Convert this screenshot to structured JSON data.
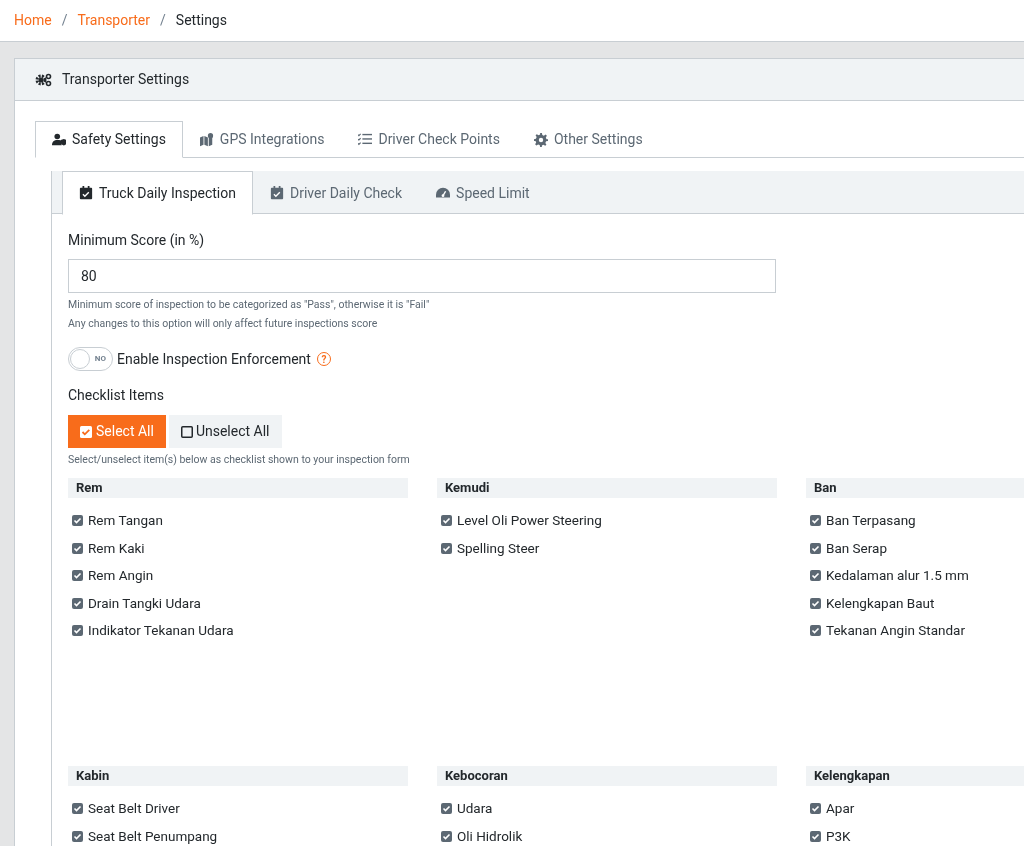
{
  "breadcrumb": [
    {
      "label": "Home",
      "link": true,
      "separator": "/"
    },
    {
      "label": "Transporter",
      "link": true,
      "separator": "/"
    },
    {
      "label": "Settings",
      "link": false
    }
  ],
  "card": {
    "title": "Transporter Settings"
  },
  "tabs": [
    {
      "label": "Safety Settings",
      "selected": true
    },
    {
      "label": "GPS Integrations",
      "selected": false
    },
    {
      "label": "Driver Check Points",
      "selected": false
    },
    {
      "label": "Other Settings",
      "selected": false
    }
  ],
  "subtabs": [
    {
      "label": "Truck Daily Inspection",
      "selected": true
    },
    {
      "label": "Driver Daily Check",
      "selected": false
    },
    {
      "label": "Speed Limit",
      "selected": false
    }
  ],
  "minimum_score": {
    "label": "Minimum Score (in %)",
    "value": "80",
    "help": [
      "Minimum score of inspection to be categorized as \"Pass\", otherwise it is \"Fail\"",
      "Any changes to this option will only affect future inspections score"
    ]
  },
  "enforcement": {
    "label": "Enable Inspection Enforcement",
    "on": false,
    "off_text": "NO",
    "help_icon": "?"
  },
  "checklist": {
    "label": "Checklist Items",
    "select_all": "Select All",
    "unselect_all": "Unselect All",
    "help": "Select/unselect item(s) below as checklist shown to your inspection form",
    "groups": [
      {
        "title": "Rem",
        "items": [
          {
            "label": "Rem Tangan",
            "checked": true
          },
          {
            "label": "Rem Kaki",
            "checked": true
          },
          {
            "label": "Rem Angin",
            "checked": true
          },
          {
            "label": "Drain Tangki Udara",
            "checked": true
          },
          {
            "label": "Indikator Tekanan Udara",
            "checked": true
          }
        ]
      },
      {
        "title": "Kemudi",
        "items": [
          {
            "label": "Level Oli Power Steering",
            "checked": true
          },
          {
            "label": "Spelling Steer",
            "checked": true
          }
        ]
      },
      {
        "title": "Ban",
        "items": [
          {
            "label": "Ban Terpasang",
            "checked": true
          },
          {
            "label": "Ban Serap",
            "checked": true
          },
          {
            "label": "Kedalaman alur 1.5 mm",
            "checked": true
          },
          {
            "label": "Kelengkapan Baut",
            "checked": true
          },
          {
            "label": "Tekanan Angin Standar",
            "checked": true
          }
        ]
      },
      {
        "title": "Kabin",
        "items": [
          {
            "label": "Seat Belt Driver",
            "checked": true
          },
          {
            "label": "Seat Belt Penumpang",
            "checked": true
          }
        ]
      },
      {
        "title": "Kebocoran",
        "items": [
          {
            "label": "Udara",
            "checked": true
          },
          {
            "label": "Oli Hidrolik",
            "checked": true
          }
        ]
      },
      {
        "title": "Kelengkapan",
        "items": [
          {
            "label": "Apar",
            "checked": true
          },
          {
            "label": "P3K",
            "checked": true
          }
        ]
      }
    ]
  }
}
